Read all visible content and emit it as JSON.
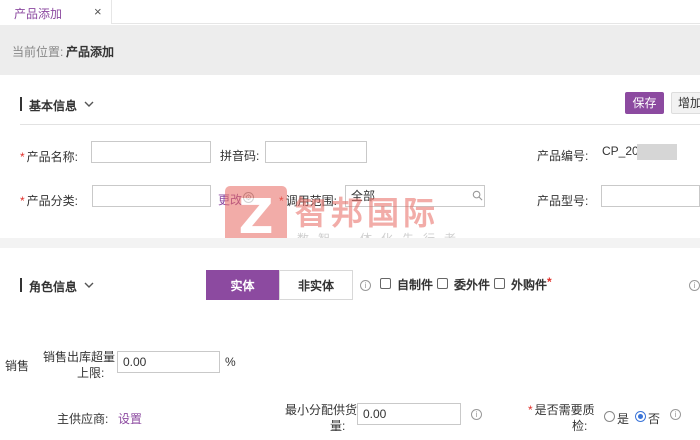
{
  "tab": {
    "label": "产品添加",
    "close": "×"
  },
  "breadcrumb": {
    "prefix": "当前位置:",
    "current": "产品添加"
  },
  "basic": {
    "title": "基本信息",
    "save": "保存",
    "add": "增加",
    "product_name_label": "产品名称:",
    "product_name_value": "",
    "pinyin_label": "拼音码:",
    "pinyin_value": "",
    "product_code_label": "产品编号:",
    "product_code_value": "CP_20          001",
    "category_label": "产品分类:",
    "category_value": "",
    "change_link": "更改",
    "scope_label": "调用范围:",
    "scope_value": "全部",
    "model_label": "产品型号:",
    "model_value": ""
  },
  "role": {
    "title": "角色信息",
    "seg_physical": "实体",
    "seg_nonphysical": "非实体",
    "chk_self": "自制件",
    "chk_outsource": "委外件",
    "chk_purchase": "外购件",
    "required_mark": "*"
  },
  "sales": {
    "section_label": "销售",
    "over_limit_label_1": "销售出库超量",
    "over_limit_label_2": "上限:",
    "over_limit_value": "0.00",
    "percent": "%",
    "supplier_label": "主供应商:",
    "supplier_link": "设置",
    "min_qty_label_1": "最小分配供货",
    "min_qty_label_2": "量:",
    "min_qty_value": "0.00",
    "qc_label_1": "是否需要质",
    "qc_label_2": "检:",
    "qc_yes": "是",
    "qc_no": "否",
    "qc_selected": "否"
  },
  "watermark": {
    "logo": "Z",
    "title": "智邦国际",
    "subtitle": "数智一体化先行者"
  },
  "colors": {
    "accent": "#8c4aa0",
    "required": "#e0302a",
    "radio": "#3a74d8"
  }
}
